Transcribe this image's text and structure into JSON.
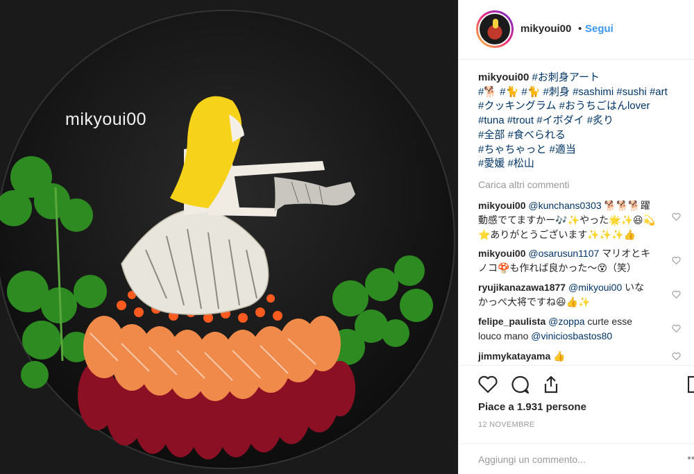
{
  "photo": {
    "watermark": "mikyoui00",
    "description_icon": "sashimi-art-photo"
  },
  "header": {
    "username": "mikyoui00",
    "separator": "•",
    "follow_label": "Segui"
  },
  "caption": {
    "username": "mikyoui00",
    "lines": [
      "#お刺身アート",
      "#🐕 #🐈 #🐈 #刺身 #sashimi #sushi #art",
      "#クッキングラム #おうちごはんlover",
      "#tuna #trout #イボダイ #炙り",
      "#全部 #食べられる",
      "#ちゃちゃっと #適当",
      "#愛媛 #松山"
    ]
  },
  "load_more_label": "Carica altri commenti",
  "comments": [
    {
      "user": "mikyoui00",
      "mention": "@kunchans0303",
      "text1": " 🐕🐕🐕躍",
      "text2": "動感でてますかー🎶✨やった🌟✨😆💫",
      "text3": "⭐ありがとうございます✨✨✨👍"
    },
    {
      "user": "mikyoui00",
      "mention": "@osarusun1107",
      "text1": " マリオとキ",
      "text2": "ノコ🍄も作れば良かった〜😵（笑）"
    },
    {
      "user": "ryujikanazawa1877",
      "mention": "@mikyoui00",
      "text1": " いな",
      "text2": "かっぺ大将ですね😆👍✨"
    },
    {
      "user": "felipe_paulista",
      "mention": "@zoppa",
      "text1": " curte esse",
      "text2": "louco mano ",
      "mention2": "@viniciosbastos80"
    },
    {
      "user": "jimmykatayama",
      "text1": " 👍"
    }
  ],
  "actions": {
    "likes": "Piace a 1.931 persone",
    "date": "12 NOVEMBRE",
    "comment_placeholder": "Aggiungi un commento...",
    "more": "•••"
  },
  "colors": {
    "link_blue": "#3897f0",
    "tag_blue": "#003569",
    "muted": "#999999",
    "text": "#262626"
  }
}
